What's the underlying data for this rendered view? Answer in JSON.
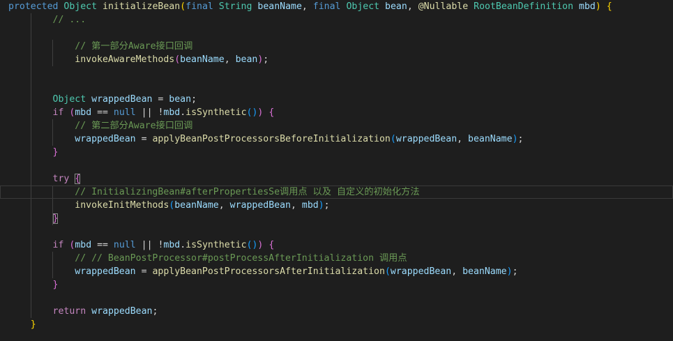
{
  "editor": {
    "lines": [
      [
        [
          "kw",
          "protected"
        ],
        [
          "pl",
          " "
        ],
        [
          "ty",
          "Object"
        ],
        [
          "pl",
          " "
        ],
        [
          "fn",
          "initializeBean"
        ],
        [
          "b1",
          "("
        ],
        [
          "kw",
          "final"
        ],
        [
          "pl",
          " "
        ],
        [
          "ty",
          "String"
        ],
        [
          "pl",
          " "
        ],
        [
          "pm",
          "beanName"
        ],
        [
          "pl",
          ", "
        ],
        [
          "kw",
          "final"
        ],
        [
          "pl",
          " "
        ],
        [
          "ty",
          "Object"
        ],
        [
          "pl",
          " "
        ],
        [
          "pm",
          "bean"
        ],
        [
          "pl",
          ", "
        ],
        [
          "fn",
          "@Nullable"
        ],
        [
          "pl",
          " "
        ],
        [
          "ty",
          "RootBeanDefinition"
        ],
        [
          "pl",
          " "
        ],
        [
          "pm",
          "mbd"
        ],
        [
          "b1",
          ")"
        ],
        [
          "pl",
          " "
        ],
        [
          "b1",
          "{"
        ]
      ],
      [
        [
          "pl",
          "        "
        ],
        [
          "cm",
          "// ..."
        ]
      ],
      [],
      [
        [
          "pl",
          "            "
        ],
        [
          "cm",
          "// 第一部分Aware接口回调"
        ]
      ],
      [
        [
          "pl",
          "            "
        ],
        [
          "fn",
          "invokeAwareMethods"
        ],
        [
          "b2",
          "("
        ],
        [
          "pm",
          "beanName"
        ],
        [
          "pl",
          ", "
        ],
        [
          "pm",
          "bean"
        ],
        [
          "b2",
          ")"
        ],
        [
          "pl",
          ";"
        ]
      ],
      [],
      [],
      [
        [
          "pl",
          "        "
        ],
        [
          "ty",
          "Object"
        ],
        [
          "pl",
          " "
        ],
        [
          "pm",
          "wrappedBean"
        ],
        [
          "pl",
          " = "
        ],
        [
          "pm",
          "bean"
        ],
        [
          "pl",
          ";"
        ]
      ],
      [
        [
          "pl",
          "        "
        ],
        [
          "kwc",
          "if"
        ],
        [
          "pl",
          " "
        ],
        [
          "b2",
          "("
        ],
        [
          "pm",
          "mbd"
        ],
        [
          "pl",
          " == "
        ],
        [
          "kw",
          "null"
        ],
        [
          "pl",
          " || !"
        ],
        [
          "pm",
          "mbd"
        ],
        [
          "pl",
          "."
        ],
        [
          "fn",
          "isSynthetic"
        ],
        [
          "b3",
          "()"
        ],
        [
          "b2",
          ")"
        ],
        [
          "pl",
          " "
        ],
        [
          "b2",
          "{"
        ]
      ],
      [
        [
          "pl",
          "            "
        ],
        [
          "cm",
          "// 第二部分Aware接口回调"
        ]
      ],
      [
        [
          "pl",
          "            "
        ],
        [
          "pm",
          "wrappedBean"
        ],
        [
          "pl",
          " = "
        ],
        [
          "fn",
          "applyBeanPostProcessorsBeforeInitialization"
        ],
        [
          "b3",
          "("
        ],
        [
          "pm",
          "wrappedBean"
        ],
        [
          "pl",
          ", "
        ],
        [
          "pm",
          "beanName"
        ],
        [
          "b3",
          ")"
        ],
        [
          "pl",
          ";"
        ]
      ],
      [
        [
          "pl",
          "        "
        ],
        [
          "b2",
          "}"
        ]
      ],
      [],
      [
        [
          "pl",
          "        "
        ],
        [
          "kwc",
          "try"
        ],
        [
          "pl",
          " "
        ],
        [
          "b2 bm",
          "{"
        ]
      ],
      [
        [
          "pl",
          "            "
        ],
        [
          "cm",
          "// InitializingBean#afterPropertiesSe调用点 以及 自定义的初始化方法"
        ]
      ],
      [
        [
          "pl",
          "            "
        ],
        [
          "fn",
          "invokeInitMethods"
        ],
        [
          "b3",
          "("
        ],
        [
          "pm",
          "beanName"
        ],
        [
          "pl",
          ", "
        ],
        [
          "pm",
          "wrappedBean"
        ],
        [
          "pl",
          ", "
        ],
        [
          "pm",
          "mbd"
        ],
        [
          "b3",
          ")"
        ],
        [
          "pl",
          ";"
        ]
      ],
      [
        [
          "pl",
          "        "
        ],
        [
          "b2 bm",
          "}"
        ]
      ],
      [],
      [
        [
          "pl",
          "        "
        ],
        [
          "kwc",
          "if"
        ],
        [
          "pl",
          " "
        ],
        [
          "b2",
          "("
        ],
        [
          "pm",
          "mbd"
        ],
        [
          "pl",
          " == "
        ],
        [
          "kw",
          "null"
        ],
        [
          "pl",
          " || !"
        ],
        [
          "pm",
          "mbd"
        ],
        [
          "pl",
          "."
        ],
        [
          "fn",
          "isSynthetic"
        ],
        [
          "b3",
          "()"
        ],
        [
          "b2",
          ")"
        ],
        [
          "pl",
          " "
        ],
        [
          "b2",
          "{"
        ]
      ],
      [
        [
          "pl",
          "            "
        ],
        [
          "cm",
          "// // BeanPostProcessor#postProcessAfterInitialization 调用点"
        ]
      ],
      [
        [
          "pl",
          "            "
        ],
        [
          "pm",
          "wrappedBean"
        ],
        [
          "pl",
          " = "
        ],
        [
          "fn",
          "applyBeanPostProcessorsAfterInitialization"
        ],
        [
          "b3",
          "("
        ],
        [
          "pm",
          "wrappedBean"
        ],
        [
          "pl",
          ", "
        ],
        [
          "pm",
          "beanName"
        ],
        [
          "b3",
          ")"
        ],
        [
          "pl",
          ";"
        ]
      ],
      [
        [
          "pl",
          "        "
        ],
        [
          "b2",
          "}"
        ]
      ],
      [],
      [
        [
          "pl",
          "        "
        ],
        [
          "kwc",
          "return"
        ],
        [
          "pl",
          " "
        ],
        [
          "pm",
          "wrappedBean"
        ],
        [
          "pl",
          ";"
        ]
      ],
      [
        [
          "pl",
          "    "
        ],
        [
          "b1",
          "}"
        ]
      ]
    ],
    "current_line": 14,
    "colors": {
      "background": "#1e1e1e",
      "keyword": "#569cd6",
      "control": "#c586c0",
      "type": "#4ec9b0",
      "function": "#dcdcaa",
      "variable": "#9cdcfe",
      "comment": "#6a9955",
      "bracket_1": "#ffd700",
      "bracket_2": "#da70d6",
      "bracket_3": "#179fff"
    }
  }
}
